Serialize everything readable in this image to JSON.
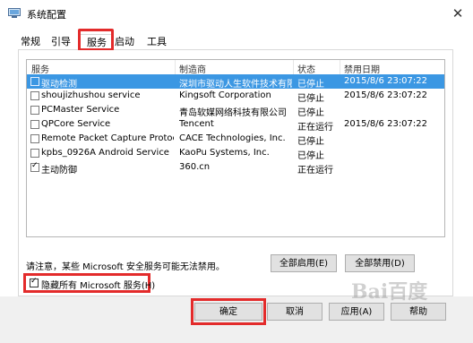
{
  "window": {
    "title": "系统配置",
    "close_glyph": "✕"
  },
  "tabs": [
    {
      "label": "常规"
    },
    {
      "label": "引导"
    },
    {
      "label": "服务"
    },
    {
      "label": "启动"
    },
    {
      "label": "工具"
    }
  ],
  "table": {
    "columns": [
      "服务",
      "制造商",
      "状态",
      "禁用日期"
    ],
    "rows": [
      {
        "checked": false,
        "service": "驱动检测",
        "maker": "深圳市驱动人生软件技术有限...",
        "status": "已停止",
        "date": "2015/8/6 23:07:22",
        "selected": true
      },
      {
        "checked": false,
        "service": "shoujizhushou service",
        "maker": "Kingsoft Corporation",
        "status": "已停止",
        "date": "2015/8/6 23:07:22"
      },
      {
        "checked": false,
        "service": "PCMaster Service",
        "maker": "青岛软媒网络科技有限公司",
        "status": "已停止",
        "date": ""
      },
      {
        "checked": false,
        "service": "QPCore Service",
        "maker": "Tencent",
        "status": "正在运行",
        "date": "2015/8/6 23:07:22"
      },
      {
        "checked": false,
        "service": "Remote Packet Capture Protocol...",
        "maker": "CACE Technologies, Inc.",
        "status": "已停止",
        "date": ""
      },
      {
        "checked": false,
        "service": "kpbs_0926A Android Service",
        "maker": "KaoPu Systems, Inc.",
        "status": "已停止",
        "date": ""
      },
      {
        "checked": true,
        "service": "主动防御",
        "maker": "360.cn",
        "status": "正在运行",
        "date": ""
      }
    ]
  },
  "note": "请注意，某些 Microsoft 安全服务可能无法禁用。",
  "buttons": {
    "enable_all": "全部启用(E)",
    "disable_all": "全部禁用(D)",
    "ok": "确定",
    "cancel": "取消",
    "apply": "应用(A)",
    "help": "帮助"
  },
  "hide_ms": {
    "label": "隐藏所有 Microsoft 服务(H)",
    "checked": true
  },
  "watermark": "Bai百度"
}
